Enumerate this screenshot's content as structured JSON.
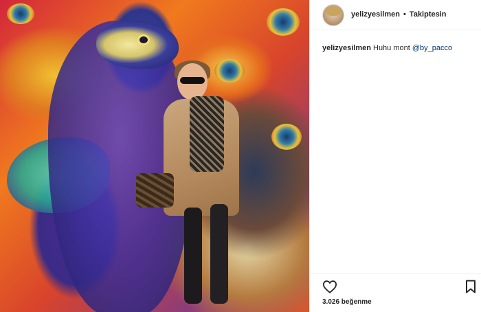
{
  "post": {
    "username": "yelizyesilmen",
    "separator": "•",
    "follow_status": "Takiptesin",
    "caption": {
      "username": "yelizyesilmen",
      "text": "Huhu mont",
      "mention": "@by_pacco"
    },
    "likes": "3.026 beğenme",
    "icons": {
      "like": "heart-icon",
      "save": "bookmark-icon"
    },
    "colors": {
      "text": "#262626",
      "mention": "#003569",
      "divider": "#efefef"
    }
  }
}
